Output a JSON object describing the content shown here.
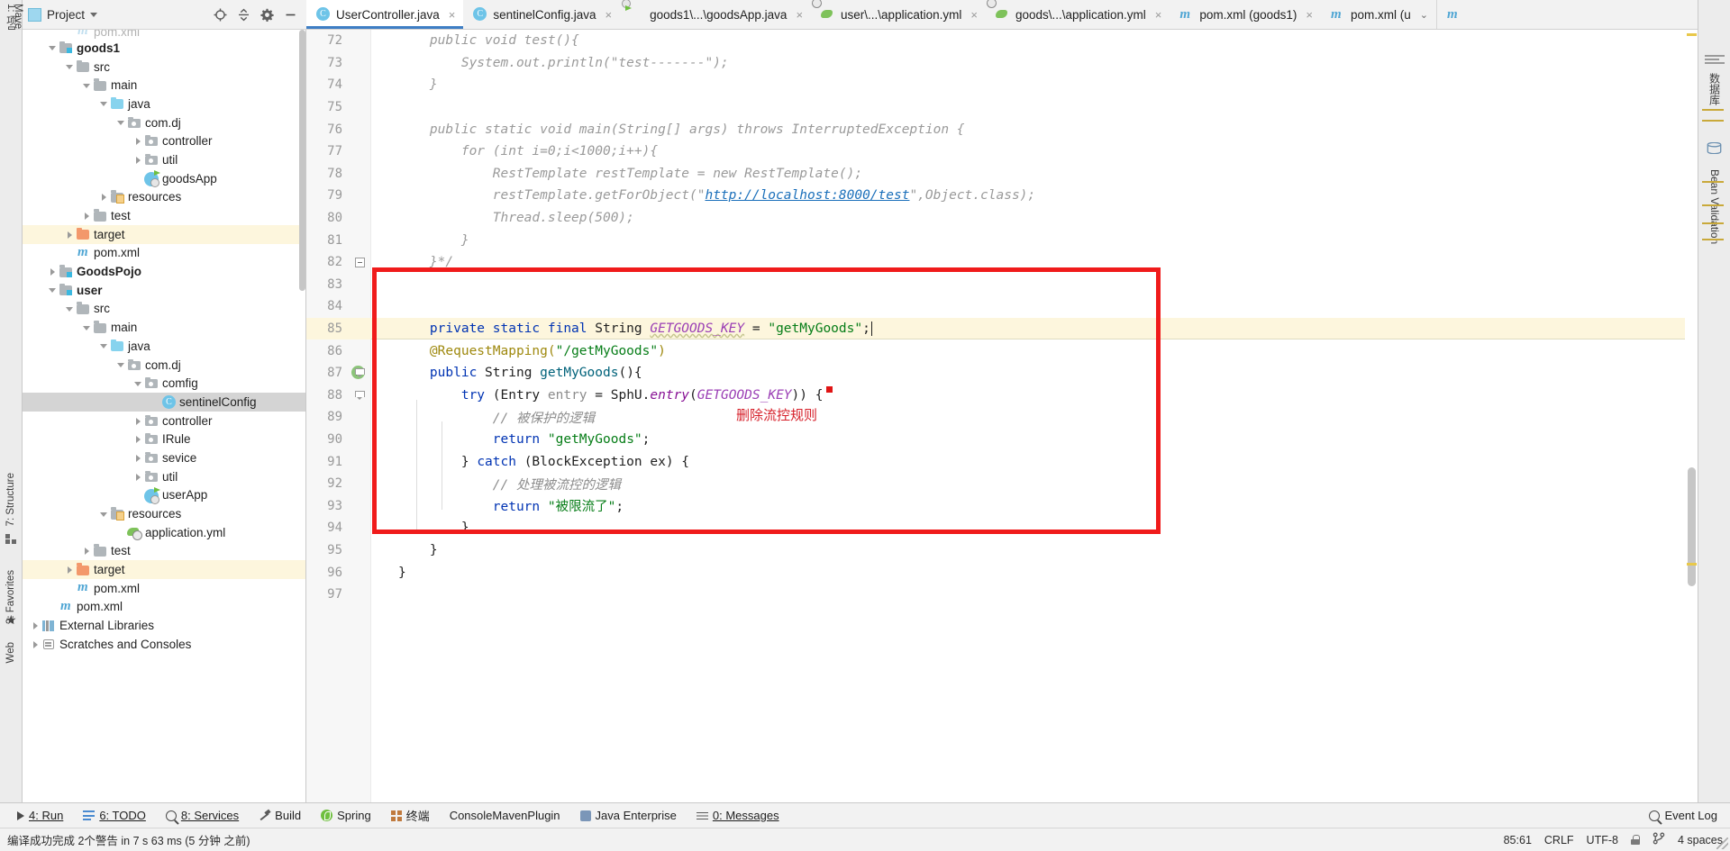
{
  "window": {
    "left_rail_top_label": "1: 项目"
  },
  "project_panel": {
    "title": "Project",
    "actions": [
      "locate-icon",
      "collapse-all-icon",
      "settings-icon",
      "minimize-icon"
    ],
    "tree": [
      {
        "label": "pom.xml",
        "indent": 2,
        "arrow": "none",
        "icon": "maven-icon",
        "bold": false,
        "state": "clipped"
      },
      {
        "label": "goods1",
        "indent": 1,
        "arrow": "down",
        "icon": "module-folder",
        "bold": true,
        "state": "normal"
      },
      {
        "label": "src",
        "indent": 2,
        "arrow": "down",
        "icon": "folder-gray",
        "bold": false,
        "state": "normal"
      },
      {
        "label": "main",
        "indent": 3,
        "arrow": "down",
        "icon": "folder-gray",
        "bold": false,
        "state": "normal"
      },
      {
        "label": "java",
        "indent": 4,
        "arrow": "down",
        "icon": "folder-source-blue",
        "bold": false,
        "state": "normal"
      },
      {
        "label": "com.dj",
        "indent": 5,
        "arrow": "down",
        "icon": "package-icon",
        "bold": false,
        "state": "normal"
      },
      {
        "label": "controller",
        "indent": 6,
        "arrow": "right",
        "icon": "package-icon",
        "bold": false,
        "state": "normal"
      },
      {
        "label": "util",
        "indent": 6,
        "arrow": "right",
        "icon": "package-icon",
        "bold": false,
        "state": "normal"
      },
      {
        "label": "goodsApp",
        "indent": 6,
        "arrow": "none",
        "icon": "springboot-class-icon",
        "bold": false,
        "state": "normal"
      },
      {
        "label": "resources",
        "indent": 4,
        "arrow": "right",
        "icon": "folder-resources",
        "bold": false,
        "state": "normal"
      },
      {
        "label": "test",
        "indent": 3,
        "arrow": "right",
        "icon": "folder-gray",
        "bold": false,
        "state": "normal"
      },
      {
        "label": "target",
        "indent": 2,
        "arrow": "right",
        "icon": "folder-orange",
        "bold": false,
        "state": "highlight"
      },
      {
        "label": "pom.xml",
        "indent": 2,
        "arrow": "none",
        "icon": "maven-icon",
        "bold": false,
        "state": "normal"
      },
      {
        "label": "GoodsPojo",
        "indent": 1,
        "arrow": "right",
        "icon": "module-folder",
        "bold": true,
        "state": "normal"
      },
      {
        "label": "user",
        "indent": 1,
        "arrow": "down",
        "icon": "module-folder",
        "bold": true,
        "state": "normal"
      },
      {
        "label": "src",
        "indent": 2,
        "arrow": "down",
        "icon": "folder-gray",
        "bold": false,
        "state": "normal"
      },
      {
        "label": "main",
        "indent": 3,
        "arrow": "down",
        "icon": "folder-gray",
        "bold": false,
        "state": "normal"
      },
      {
        "label": "java",
        "indent": 4,
        "arrow": "down",
        "icon": "folder-source-blue",
        "bold": false,
        "state": "normal"
      },
      {
        "label": "com.dj",
        "indent": 5,
        "arrow": "down",
        "icon": "package-icon",
        "bold": false,
        "state": "normal"
      },
      {
        "label": "comfig",
        "indent": 6,
        "arrow": "down",
        "icon": "package-icon",
        "bold": false,
        "state": "normal"
      },
      {
        "label": "sentinelConfig",
        "indent": 7,
        "arrow": "none",
        "icon": "class-icon",
        "bold": false,
        "state": "selected"
      },
      {
        "label": "controller",
        "indent": 6,
        "arrow": "right",
        "icon": "package-icon",
        "bold": false,
        "state": "normal"
      },
      {
        "label": "IRule",
        "indent": 6,
        "arrow": "right",
        "icon": "package-icon",
        "bold": false,
        "state": "normal"
      },
      {
        "label": "sevice",
        "indent": 6,
        "arrow": "right",
        "icon": "package-icon",
        "bold": false,
        "state": "normal"
      },
      {
        "label": "util",
        "indent": 6,
        "arrow": "right",
        "icon": "package-icon",
        "bold": false,
        "state": "normal"
      },
      {
        "label": "userApp",
        "indent": 6,
        "arrow": "none",
        "icon": "springboot-class-icon",
        "bold": false,
        "state": "normal"
      },
      {
        "label": "resources",
        "indent": 4,
        "arrow": "down",
        "icon": "folder-resources",
        "bold": false,
        "state": "normal"
      },
      {
        "label": "application.yml",
        "indent": 5,
        "arrow": "none",
        "icon": "yml-spring-icon",
        "bold": false,
        "state": "normal"
      },
      {
        "label": "test",
        "indent": 3,
        "arrow": "right",
        "icon": "folder-gray",
        "bold": false,
        "state": "normal"
      },
      {
        "label": "target",
        "indent": 2,
        "arrow": "right",
        "icon": "folder-orange",
        "bold": false,
        "state": "highlight"
      },
      {
        "label": "pom.xml",
        "indent": 2,
        "arrow": "none",
        "icon": "maven-icon",
        "bold": false,
        "state": "normal"
      },
      {
        "label": "pom.xml",
        "indent": 1,
        "arrow": "none",
        "icon": "maven-icon",
        "bold": false,
        "state": "normal"
      },
      {
        "label": "External Libraries",
        "indent": 0,
        "arrow": "right",
        "icon": "libraries-icon",
        "bold": false,
        "state": "normal"
      },
      {
        "label": "Scratches and Consoles",
        "indent": 0,
        "arrow": "right",
        "icon": "scratches-icon",
        "bold": false,
        "state": "normal"
      }
    ]
  },
  "editor_tabs": [
    {
      "label": "UserController.java",
      "icon": "class-icon",
      "active": true,
      "close": "×"
    },
    {
      "label": "sentinelConfig.java",
      "icon": "class-icon",
      "active": false,
      "close": "×"
    },
    {
      "label": "goods1\\...\\goodsApp.java",
      "icon": "springboot-class-icon",
      "active": false,
      "close": "×"
    },
    {
      "label": "user\\...\\application.yml",
      "icon": "yml-spring-icon",
      "active": false,
      "close": "×"
    },
    {
      "label": "goods\\...\\application.yml",
      "icon": "yml-spring-icon",
      "active": false,
      "close": "×"
    },
    {
      "label": "pom.xml (goods1)",
      "icon": "maven-icon",
      "active": false,
      "close": "×"
    },
    {
      "label": "pom.xml (u",
      "icon": "maven-icon",
      "active": false,
      "close": "chevron-down"
    }
  ],
  "editor": {
    "lines": [
      {
        "n": "72",
        "code": "    public void test(){",
        "style": "comment-block",
        "fold": "none",
        "gutter_icon": "none"
      },
      {
        "n": "73",
        "code": "        System.out.println(\"test-------\");",
        "style": "comment-block",
        "fold": "none",
        "gutter_icon": "none"
      },
      {
        "n": "74",
        "code": "    }",
        "style": "comment-block",
        "fold": "none",
        "gutter_icon": "none"
      },
      {
        "n": "75",
        "code": "",
        "style": "comment-block",
        "fold": "none",
        "gutter_icon": "none"
      },
      {
        "n": "76",
        "code": "    public static void main(String[] args) throws InterruptedException {",
        "style": "comment-block",
        "fold": "none",
        "gutter_icon": "none"
      },
      {
        "n": "77",
        "code": "        for (int i=0;i<1000;i++){",
        "style": "comment-block",
        "fold": "none",
        "gutter_icon": "none"
      },
      {
        "n": "78",
        "code": "            RestTemplate restTemplate = new RestTemplate();",
        "style": "comment-block",
        "fold": "none",
        "gutter_icon": "none"
      },
      {
        "n": "79",
        "code": "            restTemplate.getForObject(\"http://localhost:8000/test\",Object.class);",
        "style": "comment-block-link",
        "fold": "none",
        "gutter_icon": "none"
      },
      {
        "n": "80",
        "code": "            Thread.sleep(500);",
        "style": "comment-block",
        "fold": "none",
        "gutter_icon": "none"
      },
      {
        "n": "81",
        "code": "        }",
        "style": "comment-block",
        "fold": "none",
        "gutter_icon": "none"
      },
      {
        "n": "82",
        "code": "    }*/",
        "style": "comment-block",
        "fold": "collapse",
        "gutter_icon": "none"
      },
      {
        "n": "83",
        "code": "",
        "style": "plain",
        "fold": "none",
        "gutter_icon": "none"
      },
      {
        "n": "84",
        "code": "",
        "style": "plain",
        "fold": "none",
        "gutter_icon": "none"
      },
      {
        "n": "85",
        "code": "    private static final String GETGOODS_KEY = \"getMyGoods\";",
        "style": "decl-const",
        "fold": "none",
        "gutter_icon": "none",
        "highlight": true,
        "caret": true
      },
      {
        "n": "86",
        "code": "    @RequestMapping(\"/getMyGoods\")",
        "style": "annotation",
        "fold": "none",
        "gutter_icon": "none"
      },
      {
        "n": "87",
        "code": "    public String getMyGoods(){",
        "style": "method-decl",
        "fold": "tri",
        "gutter_icon": "web-run"
      },
      {
        "n": "88",
        "code": "        try (Entry entry = SphU.entry(GETGOODS_KEY)) {",
        "style": "try-line",
        "fold": "tri",
        "gutter_icon": "none"
      },
      {
        "n": "89",
        "code": "            // 被保护的逻辑",
        "style": "comment",
        "fold": "none",
        "gutter_icon": "none"
      },
      {
        "n": "90",
        "code": "            return \"getMyGoods\";",
        "style": "return-str",
        "fold": "none",
        "gutter_icon": "none"
      },
      {
        "n": "91",
        "code": "        } catch (BlockException ex) {",
        "style": "catch-line",
        "fold": "none",
        "gutter_icon": "none"
      },
      {
        "n": "92",
        "code": "            // 处理被流控的逻辑",
        "style": "comment",
        "fold": "none",
        "gutter_icon": "none"
      },
      {
        "n": "93",
        "code": "            return \"被限流了\";",
        "style": "return-str",
        "fold": "none",
        "gutter_icon": "none"
      },
      {
        "n": "94",
        "code": "        }",
        "style": "plain",
        "fold": "none",
        "gutter_icon": "none"
      },
      {
        "n": "95",
        "code": "    }",
        "style": "plain",
        "fold": "none",
        "gutter_icon": "none"
      },
      {
        "n": "96",
        "code": "}",
        "style": "plain",
        "fold": "none",
        "gutter_icon": "none"
      },
      {
        "n": "97",
        "code": "",
        "style": "plain",
        "fold": "none",
        "gutter_icon": "none"
      }
    ],
    "annotation": {
      "text": "删除流控规则",
      "color": "#d6202a",
      "box_color": "#f01b1b"
    }
  },
  "right_rail": [
    {
      "label": "Maven",
      "icon": "maven-icon"
    },
    {
      "label": "数据库",
      "icon": "database-icon"
    },
    {
      "label": "Bean Validation",
      "icon": "bean-icon"
    }
  ],
  "left_rail_bottom": [
    {
      "label": "7: Structure",
      "icon": "structure-icon"
    },
    {
      "label": "2: Favorites",
      "icon": "star-icon"
    },
    {
      "label": "Web",
      "icon": "web-icon"
    }
  ],
  "tool_windows": [
    {
      "label": "4: Run",
      "num": "4",
      "icon": "run-icon"
    },
    {
      "label": "6: TODO",
      "num": "6",
      "icon": "todo-icon"
    },
    {
      "label": "8: Services",
      "num": "8",
      "icon": "services-icon"
    },
    {
      "label": "Build",
      "num": "",
      "icon": "build-icon"
    },
    {
      "label": "Spring",
      "num": "",
      "icon": "spring-icon"
    },
    {
      "label": "终端",
      "num": "",
      "icon": "terminal-icon"
    },
    {
      "label": "ConsoleMavenPlugin",
      "num": "",
      "icon": "none"
    },
    {
      "label": "Java Enterprise",
      "num": "",
      "icon": "java-ee-icon"
    },
    {
      "label": "0: Messages",
      "num": "0",
      "icon": "messages-icon"
    }
  ],
  "status_bar": {
    "message": "编译成功完成 2个警告 in 7 s 63 ms (5 分钟 之前)",
    "event_log": "Event Log",
    "caret_position": "85:61",
    "line_separator": "CRLF",
    "encoding": "UTF-8",
    "indent": "4 spaces",
    "lock_icon": "lock-icon",
    "branch_icon": "branch-icon"
  }
}
